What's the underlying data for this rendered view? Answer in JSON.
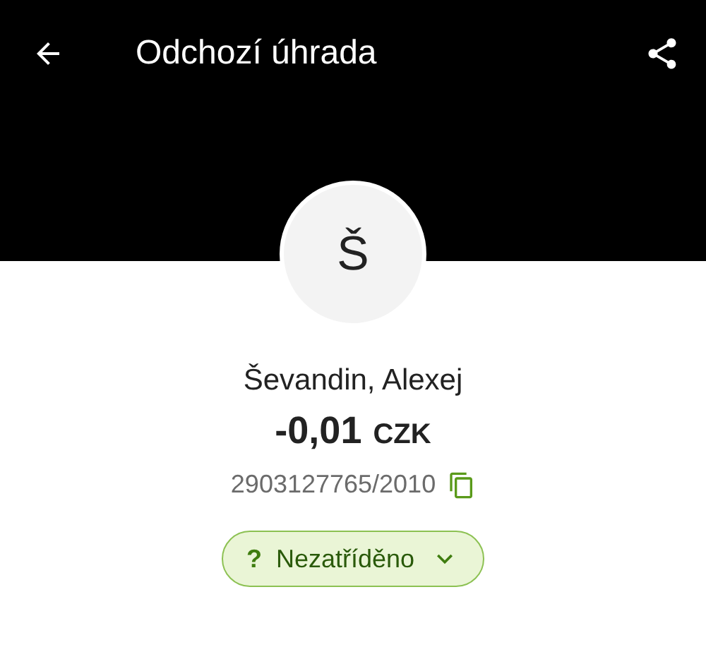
{
  "app_bar": {
    "title": "Odchozí úhrada"
  },
  "avatar": {
    "initial": "Š"
  },
  "counterparty": {
    "name": "Ševandin, Alexej"
  },
  "amount": {
    "value": "-0,01",
    "currency": "CZK"
  },
  "account": {
    "number": "2903127765/2010"
  },
  "category": {
    "icon": "?",
    "label": "Nezatříděno"
  }
}
